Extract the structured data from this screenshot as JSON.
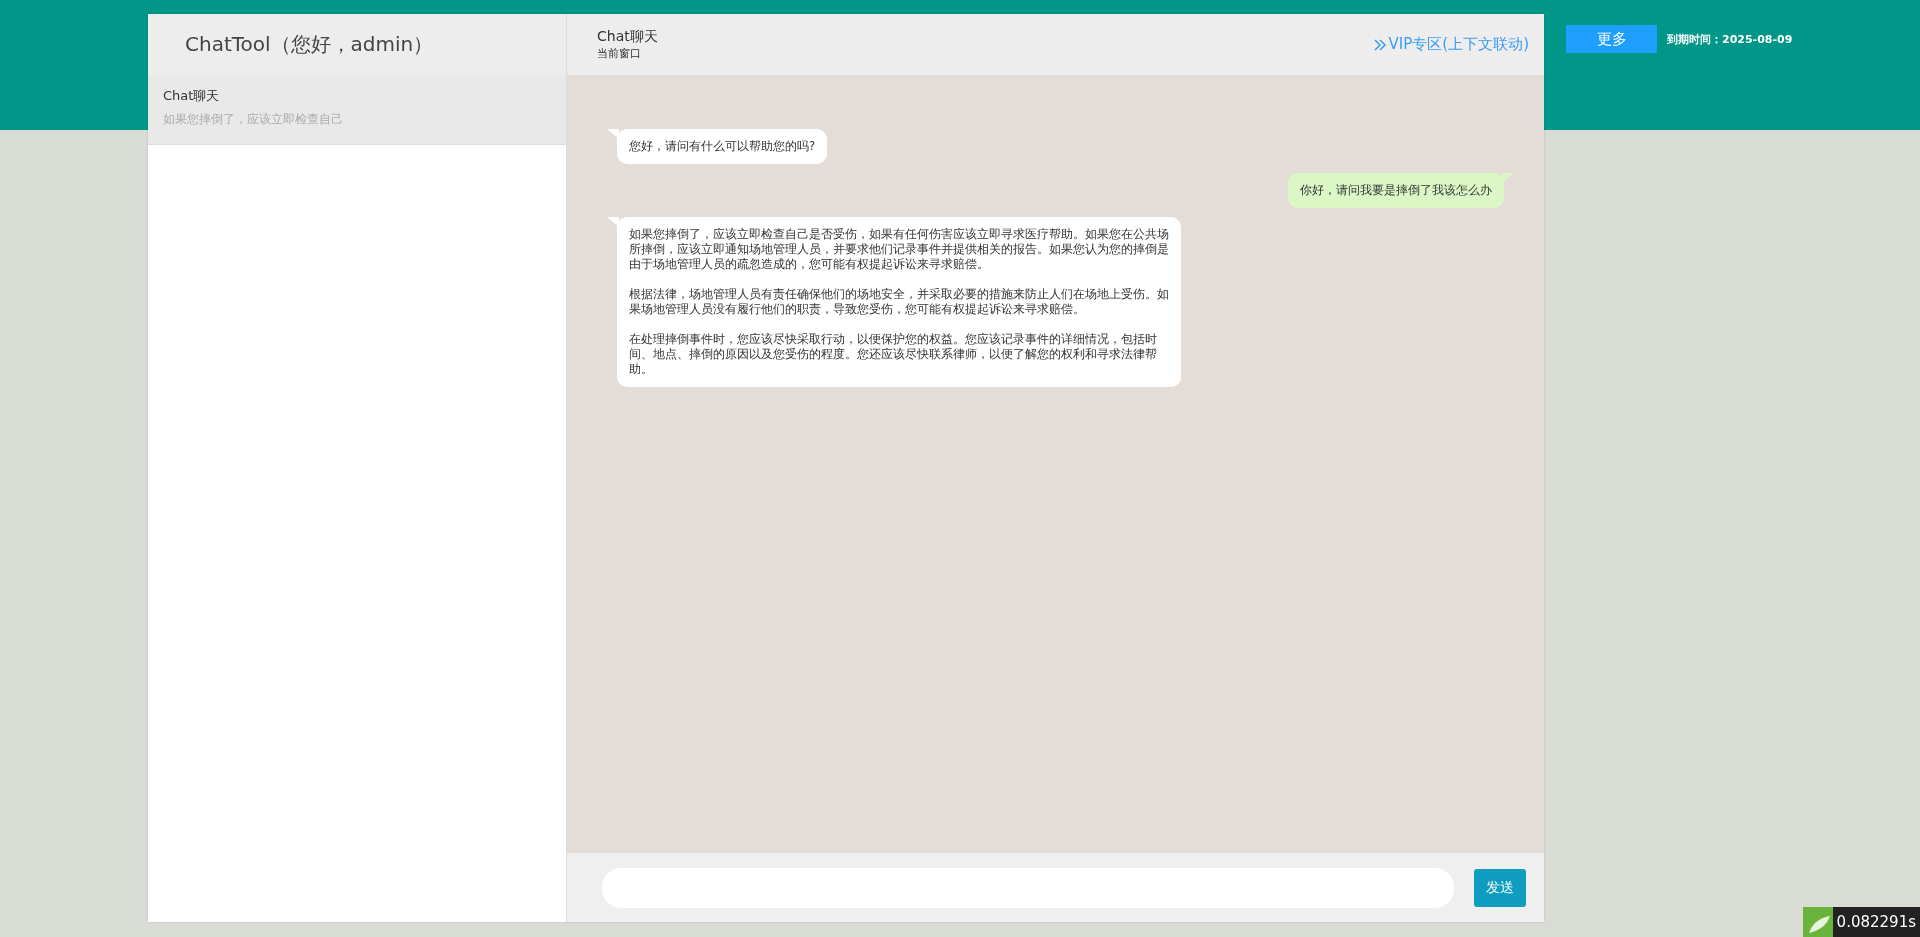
{
  "sidebar": {
    "title": "ChatTool（您好，admin）",
    "items": [
      {
        "name": "Chat聊天",
        "preview": "如果您摔倒了，应该立即检查自己",
        "selected": true
      }
    ]
  },
  "chat_header": {
    "title": "Chat聊天",
    "subtitle": "当前窗口",
    "vip_link": "VIP专区(上下文联动)"
  },
  "messages": [
    {
      "kind": "bot",
      "paragraphs": [
        "您好，请问有什么可以帮助您的吗?"
      ]
    },
    {
      "kind": "user",
      "paragraphs": [
        "你好，请问我要是摔倒了我该怎么办"
      ]
    },
    {
      "kind": "bot",
      "paragraphs": [
        "如果您摔倒了，应该立即检查自己是否受伤，如果有任何伤害应该立即寻求医疗帮助。如果您在公共场所摔倒，应该立即通知场地管理人员，并要求他们记录事件并提供相关的报告。如果您认为您的摔倒是由于场地管理人员的疏忽造成的，您可能有权提起诉讼来寻求赔偿。",
        "根据法律，场地管理人员有责任确保他们的场地安全，并采取必要的措施来防止人们在场地上受伤。如果场地管理人员没有履行他们的职责，导致您受伤，您可能有权提起诉讼来寻求赔偿。",
        "在处理摔倒事件时，您应该尽快采取行动，以便保护您的权益。您应该记录事件的详细情况，包括时间、地点、摔倒的原因以及您受伤的程度。您还应该尽快联系律师，以便了解您的权利和寻求法律帮助。"
      ]
    }
  ],
  "composer": {
    "send_button": "发送"
  },
  "top_right": {
    "more_button": "更多",
    "expiry": "到期时间：2025-08-09"
  },
  "trace_badge": {
    "time": "0.082291s"
  }
}
